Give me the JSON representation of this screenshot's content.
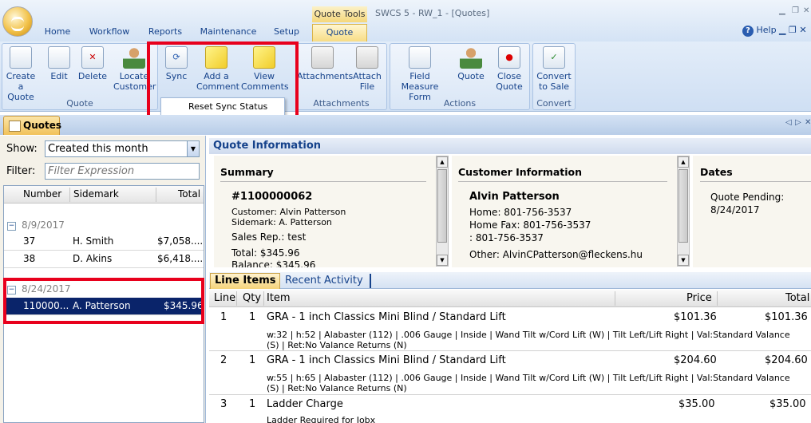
{
  "window": {
    "title": "SWCS 5 - RW_1 - [Quotes]",
    "context_tab_group": "Quote Tools",
    "help_label": "Help"
  },
  "ribbon": {
    "tabs": [
      "Home",
      "Workflow",
      "Reports",
      "Maintenance",
      "Setup",
      "Quote"
    ],
    "active_tab": "Quote",
    "buttons": {
      "create_quote": "Create a\nQuote",
      "edit": "Edit",
      "delete": "Delete",
      "locate_customer": "Locate\nCustomer",
      "sync": "Sync",
      "add_comment": "Add a\nComment",
      "view_comments": "View\nComments",
      "attachments": "Attachments",
      "attach_file": "Attach\nFile",
      "field_measure": "Field Measure\nForm",
      "quote": "Quote",
      "close_quote": "Close\nQuote",
      "convert_to_sale": "Convert\nto Sale"
    },
    "groups": {
      "quote": "Quote",
      "attachments": "Attachments",
      "actions": "Actions",
      "convert": "Convert"
    },
    "sync_dropdown": {
      "item": "Reset Sync Status"
    }
  },
  "quotes_tab": {
    "label": "Quotes"
  },
  "left_panel": {
    "show_label": "Show:",
    "show_value": "Created this month",
    "filter_label": "Filter:",
    "filter_placeholder": "Filter Expression",
    "columns": [
      "Number",
      "Sidemark",
      "Total"
    ],
    "groups": [
      {
        "date": "8/9/2017",
        "rows": [
          {
            "number": "37",
            "sidemark": "H. Smith",
            "total": "$7,058...."
          },
          {
            "number": "38",
            "sidemark": "D. Akins",
            "total": "$6,418...."
          }
        ]
      },
      {
        "date": "8/24/2017",
        "rows": [
          {
            "number": "110000...",
            "sidemark": "A. Patterson",
            "total": "$345.96"
          }
        ]
      }
    ]
  },
  "quote_info": {
    "header": "Quote Information",
    "summary": {
      "title": "Summary",
      "number": "#1100000062",
      "customer": "Customer: Alvin Patterson",
      "sidemark": "Sidemark: A. Patterson",
      "sales_rep": "Sales Rep.: test",
      "total": "Total: $345.96",
      "balance": "Balance: $345.96"
    },
    "customer": {
      "title": "Customer Information",
      "name": "Alvin Patterson",
      "home": "Home: 801-756-3537",
      "home_fax": "Home Fax: 801-756-3537",
      "other_phone": ": 801-756-3537",
      "other": "Other: AlvinCPatterson@fleckens.hu"
    },
    "dates": {
      "title": "Dates",
      "label": "Quote Pending:",
      "value": "8/24/2017"
    }
  },
  "detail_tabs": [
    "Line Items",
    "Recent Activity"
  ],
  "line_items": {
    "columns": {
      "line": "Line",
      "qty": "Qty",
      "item": "Item",
      "price": "Price",
      "total": "Total"
    },
    "rows": [
      {
        "line": "1",
        "qty": "1",
        "item": "GRA - 1 inch Classics Mini Blind / Standard Lift",
        "price": "$101.36",
        "total": "$101.36",
        "desc": "w:32 | h:52 | Alabaster (112) | .006 Gauge | Inside | Wand Tilt w/Cord Lift (W) | Tilt Left/Lift Right | Val:Standard Valance (S) | Ret:No Valance Returns (N)"
      },
      {
        "line": "2",
        "qty": "1",
        "item": "GRA - 1 inch Classics Mini Blind / Standard Lift",
        "price": "$204.60",
        "total": "$204.60",
        "desc": "w:55 | h:65 | Alabaster (112) | .006 Gauge | Inside | Wand Tilt w/Cord Lift (W) | Tilt Left/Lift Right | Val:Standard Valance (S) | Ret:No Valance Returns (N)"
      },
      {
        "line": "3",
        "qty": "1",
        "item": "Ladder Charge",
        "price": "$35.00",
        "total": "$35.00",
        "desc": "Ladder Required for Jobx"
      }
    ]
  }
}
